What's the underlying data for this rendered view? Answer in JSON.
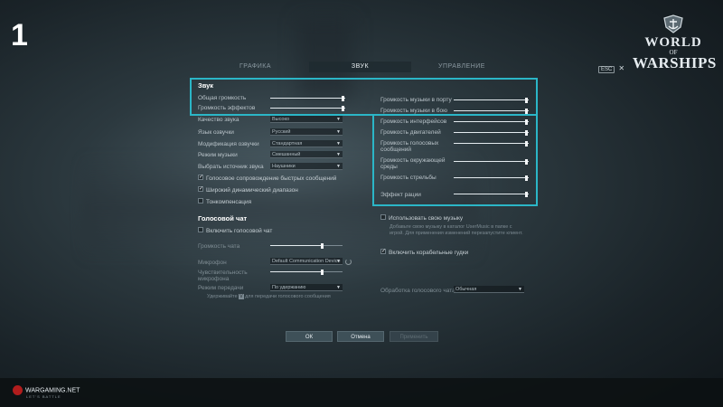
{
  "step_number": "1",
  "logo": {
    "line1": "WORLD",
    "line2": "OF",
    "line3": "WARSHIPS"
  },
  "tabs": [
    "ГРАФИКА",
    "ЗВУК",
    "УПРАВЛЕНИЕ"
  ],
  "esc": {
    "key": "ESC",
    "close": "✕"
  },
  "sound": {
    "title": "Звук",
    "left_sliders": [
      {
        "label": "Общая громкость",
        "value": 1.0
      },
      {
        "label": "Громкость эффектов",
        "value": 1.0
      }
    ],
    "selects": [
      {
        "label": "Качество звука",
        "value": "Высоко"
      },
      {
        "label": "Язык озвучки",
        "value": "Русский"
      },
      {
        "label": "Модификация озвучки",
        "value": "Стандартная"
      },
      {
        "label": "Режим музыки",
        "value": "Смешанный"
      },
      {
        "label": "Выбрать источник звука",
        "value": "Наушники"
      }
    ],
    "checks": [
      {
        "label": "Голосовое сопровождение быстрых сообщений",
        "checked": true
      },
      {
        "label": "Широкий динамический диапазон",
        "checked": true
      },
      {
        "label": "Тонкомпенсация",
        "checked": false
      }
    ],
    "right_sliders": [
      {
        "label": "Громкость музыки в порту",
        "value": 1.0
      },
      {
        "label": "Громкость музыки в бою",
        "value": 1.0
      },
      {
        "label": "Громкость интерфейсов",
        "value": 1.0
      },
      {
        "label": "Громкость двигателей",
        "value": 1.0
      },
      {
        "label": "Громкость голосовых сообщений",
        "value": 1.0
      },
      {
        "label": "Громкость окружающей среды",
        "value": 1.0
      },
      {
        "label": "Громкость стрельбы",
        "value": 1.0
      },
      {
        "label": "Эффект рации",
        "value": 1.0
      }
    ]
  },
  "custom_music": {
    "label": "Использовать свою музыку",
    "note": "Добавьте свою музыку в каталог UserMusic в папке с игрой. Для применения изменений перезапустите клиент.",
    "ship_horns": "Включить корабельные гудки"
  },
  "voice_chat": {
    "title": "Голосовой чат",
    "enable": "Включить голосовой чат",
    "chat_volume": {
      "label": "Громкость чата",
      "value": 0.8
    },
    "microphone": {
      "label": "Микрофон",
      "value": "Default Communication Device"
    },
    "mic_sensitivity": {
      "label": "Чувствительность микрофона",
      "value": 0.8
    },
    "transmit_mode": {
      "label": "Режим передачи",
      "value": "По удержанию"
    },
    "hint_pre": "Удерживайте",
    "hint_key": "V",
    "hint_post": "для передачи голосового сообщения",
    "processing": {
      "label": "Обработка голосового чата",
      "value": "Обычная"
    }
  },
  "buttons": {
    "ok": "ОК",
    "cancel": "Отмена",
    "apply": "Применить"
  },
  "footer": {
    "brand": "WARGAMING.NET",
    "tagline": "LET'S BATTLE"
  },
  "colors": {
    "highlight": "#2bb6c7",
    "background": "#2c393f"
  }
}
